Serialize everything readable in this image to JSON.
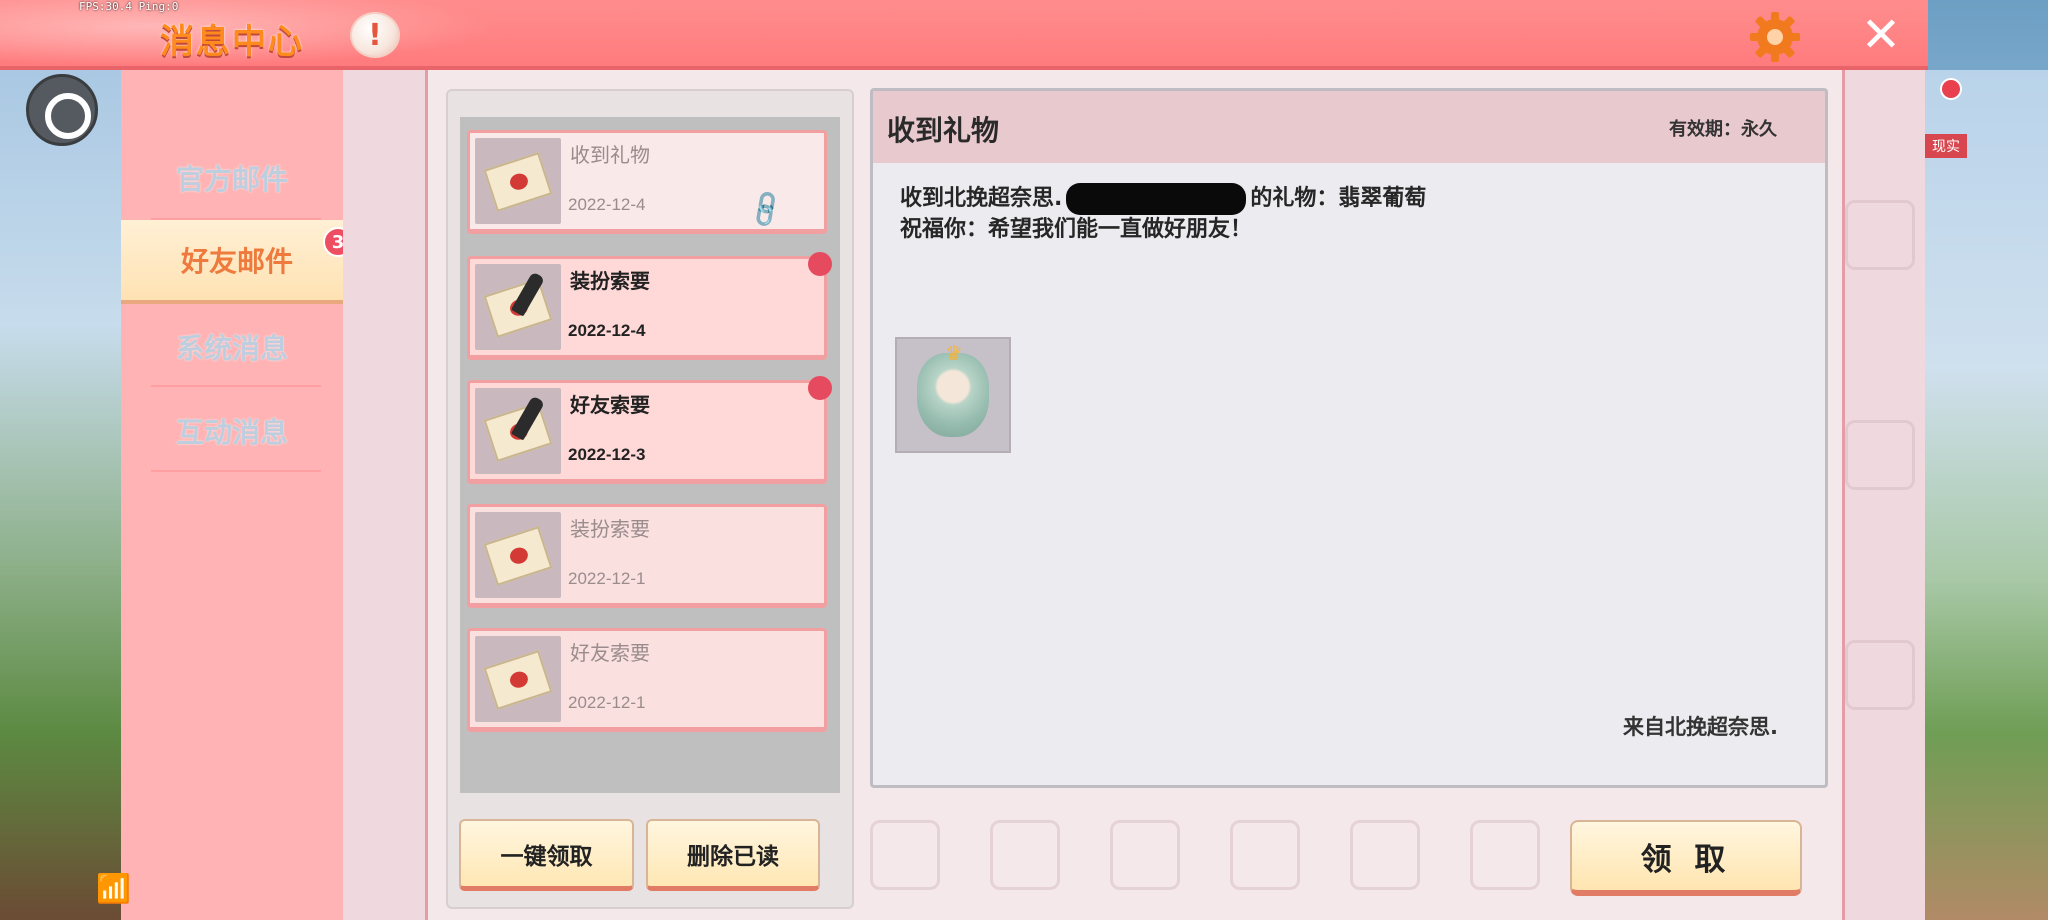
{
  "hud": {
    "fps_text": "FPS:30.4  Ping:0"
  },
  "header": {
    "title": "消息中心",
    "info_symbol": "!",
    "close_symbol": "✕"
  },
  "sidebar": {
    "items": [
      {
        "label": "官方邮件",
        "active": false
      },
      {
        "label": "好友邮件",
        "active": true,
        "badge": "3"
      },
      {
        "label": "系统消息",
        "active": false
      },
      {
        "label": "互动消息",
        "active": false
      }
    ]
  },
  "mail_list": {
    "items": [
      {
        "title": "收到礼物",
        "date": "2022-12-4",
        "read": true,
        "attachment": true,
        "unread_dot": false
      },
      {
        "title": "装扮索要",
        "date": "2022-12-4",
        "read": false,
        "attachment": false,
        "unread_dot": true
      },
      {
        "title": "好友索要",
        "date": "2022-12-3",
        "read": false,
        "attachment": false,
        "unread_dot": true
      },
      {
        "title": "装扮索要",
        "date": "2022-12-1",
        "read": true,
        "attachment": false,
        "unread_dot": false
      },
      {
        "title": "好友索要",
        "date": "2022-12-1",
        "read": true,
        "attachment": false,
        "unread_dot": false
      }
    ],
    "claim_all_label": "一键领取",
    "delete_read_label": "删除已读"
  },
  "detail": {
    "title": "收到礼物",
    "validity": "有效期：永久",
    "body_prefix": "收到北挽超奈思.",
    "body_suffix": "的礼物：翡翠葡萄",
    "body_line2": "祝福你：希望我们能一直做好朋友！",
    "from": "来自北挽超奈思.",
    "claim_label": "领 取"
  },
  "right_edge": {
    "tag_text": "现实"
  },
  "colors": {
    "header": "#ff7b7d",
    "sidebar": "#ffb3b4",
    "accent_orange": "#ee7b3d",
    "unread_red": "#e54a5f"
  }
}
